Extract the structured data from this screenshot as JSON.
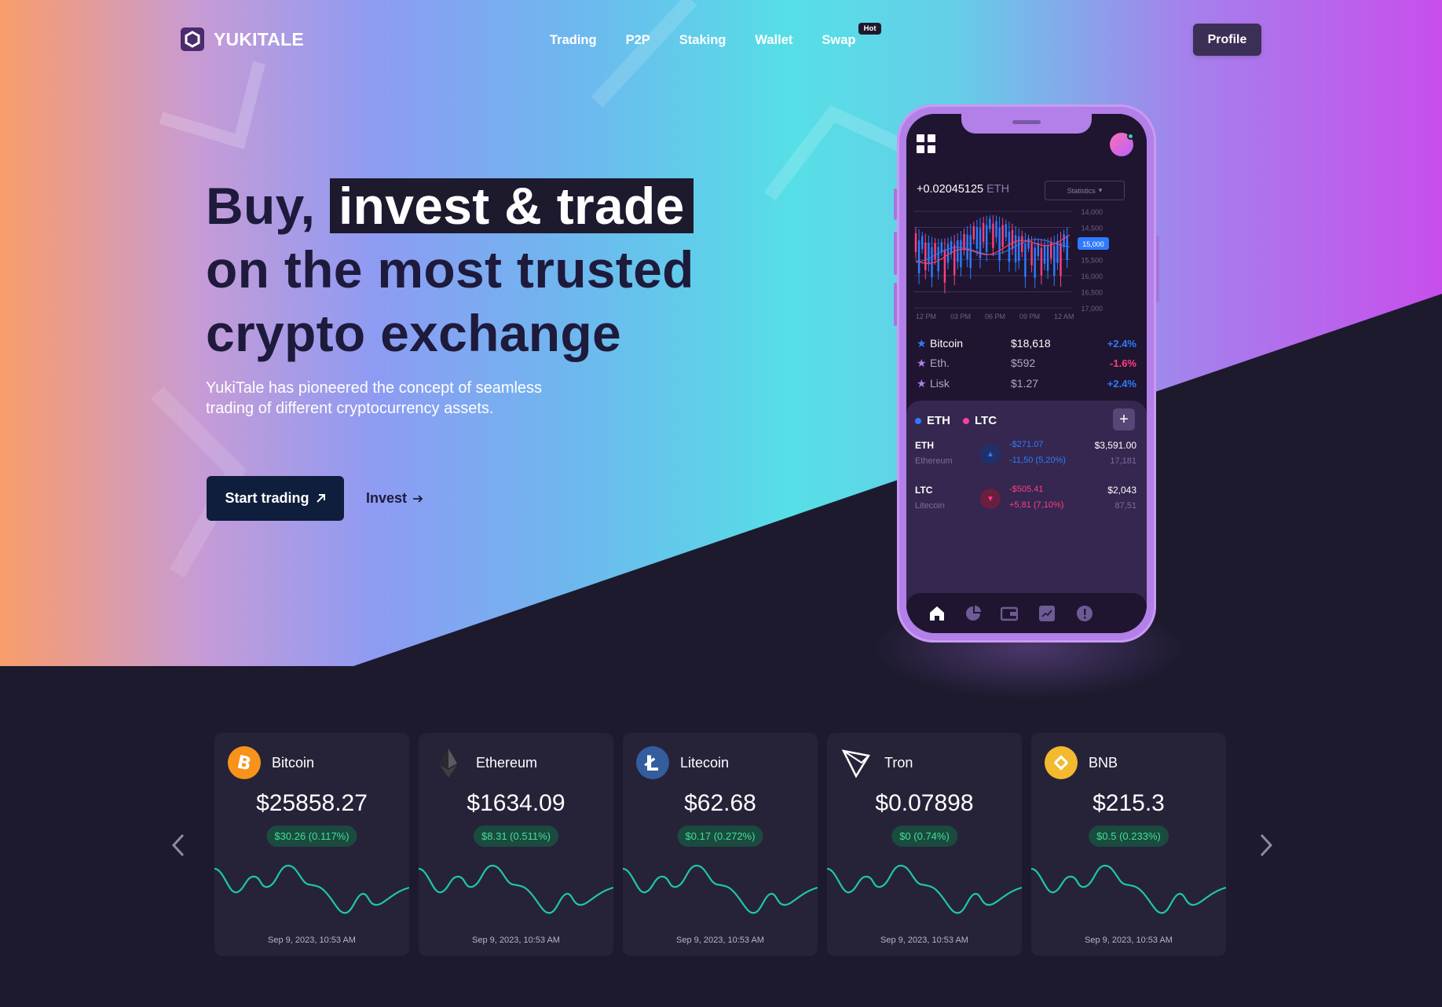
{
  "brand": {
    "name": "YUKITALE"
  },
  "nav": {
    "items": [
      "Trading",
      "P2P",
      "Staking",
      "Wallet",
      "Swap"
    ],
    "hot_badge": "Hot",
    "profile_label": "Profile"
  },
  "hero": {
    "line1_prefix": "Buy,",
    "line1_highlight": "invest & trade",
    "line2": "on the most trusted",
    "line3": "crypto exchange",
    "subtext": "YukiTale has pioneered the concept of seamless trading of different cryptocurrency assets.",
    "cta_primary": "Start trading",
    "cta_secondary": "Invest"
  },
  "phone": {
    "balance_value": "+0.02045125",
    "balance_unit": "ETH",
    "stats_label": "Statistics",
    "chart": {
      "y_ticks": [
        "14,000",
        "14,500",
        "15,000",
        "15,500",
        "16,000",
        "16,500",
        "17,000"
      ],
      "x_ticks": [
        "12 PM",
        "03 PM",
        "06 PM",
        "09 PM",
        "12 AM"
      ],
      "current_label": "15,000"
    },
    "coins": [
      {
        "name": "Bitcoin",
        "price": "$18,618",
        "change": "+2.4%",
        "dir": "up"
      },
      {
        "name": "Eth.",
        "price": "$592",
        "change": "-1.6%",
        "dir": "down"
      },
      {
        "name": "Lisk",
        "price": "$1.27",
        "change": "+2.4%",
        "dir": "up"
      }
    ],
    "pair_tabs": [
      "ETH",
      "LTC"
    ],
    "pairs": [
      {
        "symbol": "ETH",
        "name": "Ethereum",
        "delta1": "-$271.07",
        "delta2": "-11,50 (5,20%)",
        "value": "$3,591.00",
        "volume": "17,181",
        "dir": "up"
      },
      {
        "symbol": "LTC",
        "name": "Litecoin",
        "delta1": "-$505.41",
        "delta2": "+5,81 (7,10%)",
        "value": "$2,043",
        "volume": "87,51",
        "dir": "down"
      }
    ]
  },
  "cards": [
    {
      "name": "Bitcoin",
      "price": "$25858.27",
      "change": "$30.26 (0.117%)",
      "date": "Sep 9, 2023, 10:53 AM",
      "icon": "bitcoin-icon",
      "color": "#f7931a"
    },
    {
      "name": "Ethereum",
      "price": "$1634.09",
      "change": "$8.31 (0.511%)",
      "date": "Sep 9, 2023, 10:53 AM",
      "icon": "ethereum-icon",
      "color": "#3c3c3d"
    },
    {
      "name": "Litecoin",
      "price": "$62.68",
      "change": "$0.17 (0.272%)",
      "date": "Sep 9, 2023, 10:53 AM",
      "icon": "litecoin-icon",
      "color": "#345d9d"
    },
    {
      "name": "Tron",
      "price": "$0.07898",
      "change": "$0 (0.74%)",
      "date": "Sep 9, 2023, 10:53 AM",
      "icon": "tron-icon",
      "color": "#ffffff"
    },
    {
      "name": "BNB",
      "price": "$215.3",
      "change": "$0.5 (0.233%)",
      "date": "Sep 9, 2023, 10:53 AM",
      "icon": "bnb-icon",
      "color": "#f3ba2f"
    }
  ],
  "colors": {
    "accent_dark": "#1d1a2e",
    "positive": "#2f7bff",
    "negative": "#ff3f7f",
    "spark": "#1fc7a6",
    "phone": "#b37fe8"
  }
}
